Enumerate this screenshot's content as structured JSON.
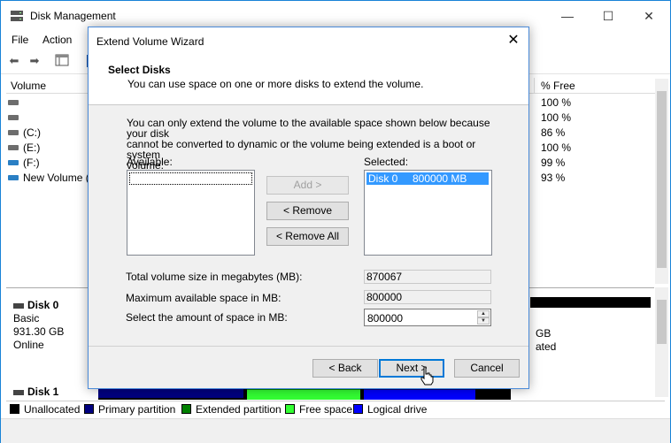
{
  "app": {
    "title": "Disk Management",
    "window_controls": {
      "minimize": "—",
      "maximize": "☐",
      "close": "✕"
    }
  },
  "menu": {
    "file": "File",
    "action": "Action"
  },
  "volume_list": {
    "columns": {
      "volume": "Volume",
      "free_pct": "% Free"
    },
    "rows": [
      {
        "name": "",
        "free": "100 %"
      },
      {
        "name": "",
        "free": "100 %"
      },
      {
        "name": "(C:)",
        "free": "86 %"
      },
      {
        "name": "(E:)",
        "free": "100 %"
      },
      {
        "name": "(F:)",
        "free": "99 %"
      },
      {
        "name": "New Volume (",
        "free": "93 %"
      }
    ]
  },
  "disks": {
    "disk0": {
      "title": "Disk 0",
      "type": "Basic",
      "size": "931.30 GB",
      "status": "Online",
      "peek_line1": "GB",
      "peek_line2": "ated"
    },
    "disk1": {
      "title": "Disk 1"
    }
  },
  "legend": [
    {
      "label": "Unallocated",
      "color": "#000000"
    },
    {
      "label": "Primary partition",
      "color": "#000080"
    },
    {
      "label": "Extended partition",
      "color": "#008000"
    },
    {
      "label": "Free space",
      "color": "#33ff33"
    },
    {
      "label": "Logical drive",
      "color": "#0000ff"
    }
  ],
  "wizard": {
    "title": "Extend Volume Wizard",
    "close": "✕",
    "step_title": "Select Disks",
    "step_subtitle": "You can use space on one or more disks to extend the volume.",
    "info_line1": "You can only extend the volume to the available space shown below because your disk",
    "info_line2": "cannot be converted to dynamic or the volume being extended is a boot or system",
    "info_line3": "volume.",
    "available_label": "Available:",
    "selected_label": "Selected:",
    "selected_items": [
      "Disk 0     800000 MB"
    ],
    "add_button": "Add >",
    "remove_button": "< Remove",
    "remove_all_button": "< Remove All",
    "total_size_label": "Total volume size in megabytes (MB):",
    "total_size_value": "870067",
    "max_space_label": "Maximum available space in MB:",
    "max_space_value": "800000",
    "select_space_label": "Select the amount of space in MB:",
    "select_space_value": "800000",
    "back_button": "< Back",
    "next_button": "Next >",
    "cancel_button": "Cancel"
  }
}
